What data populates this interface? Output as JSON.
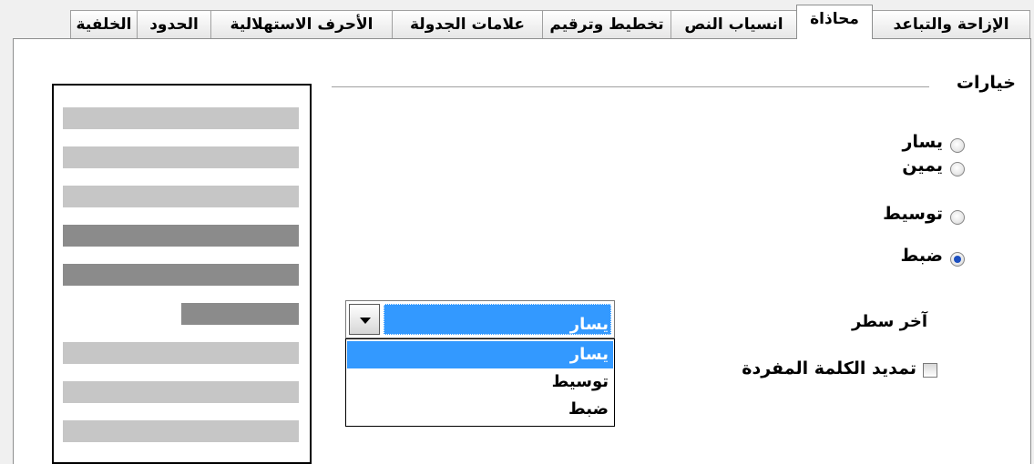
{
  "tabs": [
    {
      "id": "indents",
      "label": "الإزاحة والتباعد",
      "active": false
    },
    {
      "id": "alignment",
      "label": "محاذاة",
      "active": true
    },
    {
      "id": "textflow",
      "label": "انسياب النص",
      "active": false
    },
    {
      "id": "outline",
      "label": "تخطيط وترقيم",
      "active": false
    },
    {
      "id": "tabs",
      "label": "علامات الجدولة",
      "active": false
    },
    {
      "id": "dropcaps",
      "label": "الأحرف الاستهلالية",
      "active": false
    },
    {
      "id": "borders",
      "label": "الحدود",
      "active": false
    },
    {
      "id": "background",
      "label": "الخلفية",
      "active": false
    }
  ],
  "options": {
    "title": "خيارات",
    "radios": [
      {
        "id": "left",
        "label": "يسار",
        "checked": false
      },
      {
        "id": "right",
        "label": "يمين",
        "checked": false
      },
      {
        "id": "center",
        "label": "توسيط",
        "checked": false
      },
      {
        "id": "justify",
        "label": "ضبط",
        "checked": true
      }
    ],
    "last_line_label": "آخر سطر",
    "last_line": {
      "value": "يسار",
      "options": [
        "يسار",
        "توسيط",
        "ضبط"
      ],
      "highlighted_index": 0
    },
    "expand_single_word": {
      "label": "تمديد الكلمة المفردة",
      "checked": false
    }
  },
  "preview": {
    "lines": [
      "light",
      "light",
      "light",
      "dark",
      "dark",
      "dark-short",
      "light",
      "light",
      "light"
    ]
  },
  "colors": {
    "selection": "#3399ff",
    "radio_dot": "#1c4fbf",
    "preview_light": "#c6c6c6",
    "preview_dark": "#8b8b8b"
  }
}
